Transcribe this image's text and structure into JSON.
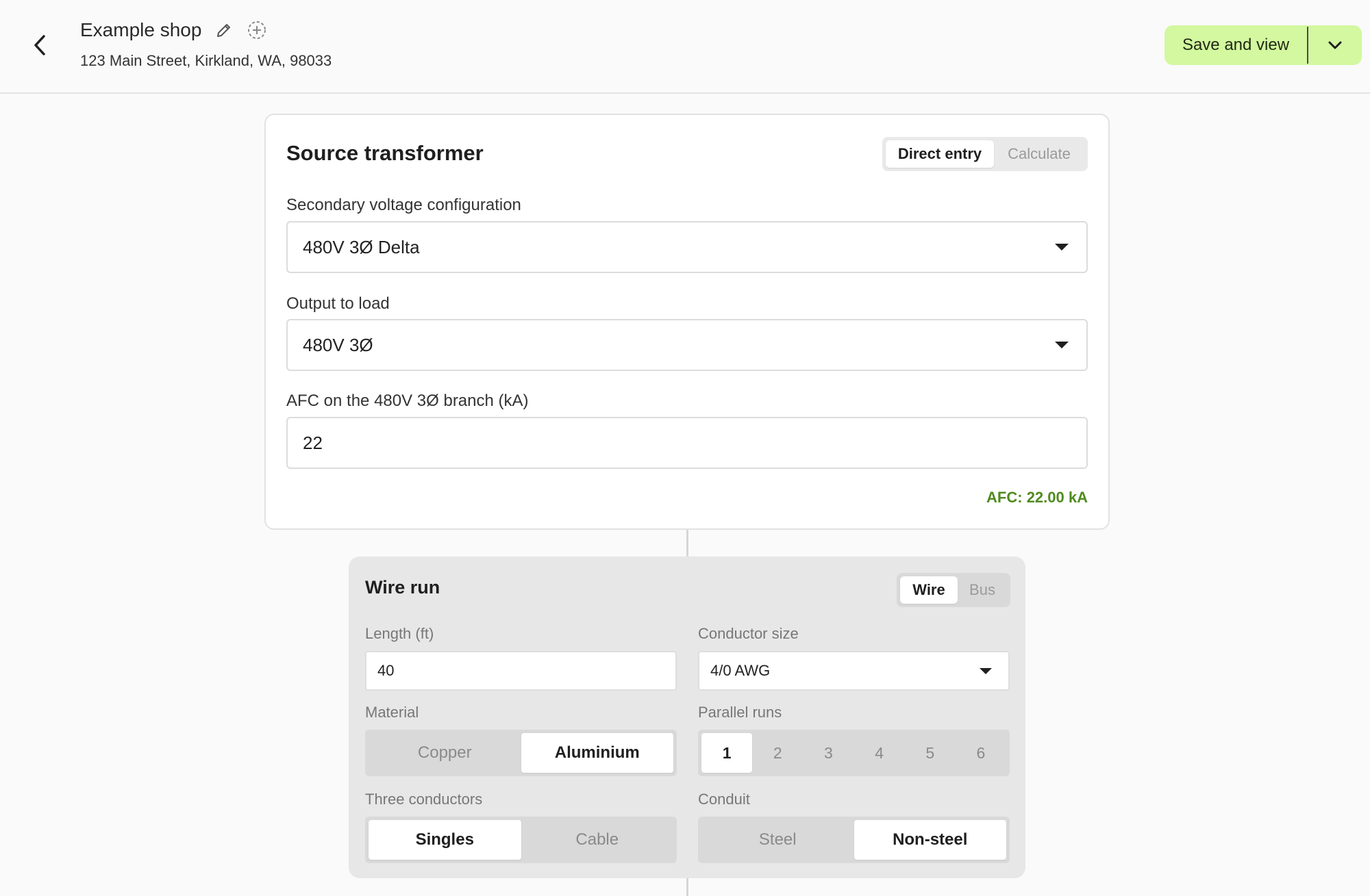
{
  "header": {
    "title": "Example shop",
    "address": "123 Main Street, Kirkland, WA, 98033",
    "save_label": "Save and view"
  },
  "source_transformer": {
    "title": "Source transformer",
    "mode_options": [
      "Direct entry",
      "Calculate"
    ],
    "mode_selected": "Direct entry",
    "secondary_voltage_label": "Secondary voltage configuration",
    "secondary_voltage_value": "480V 3Ø Delta",
    "output_label": "Output to load",
    "output_value": "480V 3Ø",
    "afc_label": "AFC on the 480V 3Ø branch (kA)",
    "afc_value": "22",
    "afc_result": "AFC: 22.00 kA",
    "afc_result_color": "#4f8a1f"
  },
  "wire_run": {
    "title": "Wire run",
    "type_options": [
      "Wire",
      "Bus"
    ],
    "type_selected": "Wire",
    "length_label": "Length (ft)",
    "length_value": "40",
    "conductor_label": "Conductor size",
    "conductor_value": "4/0 AWG",
    "material_label": "Material",
    "material_options": [
      "Copper",
      "Aluminium"
    ],
    "material_selected": "Aluminium",
    "parallel_label": "Parallel runs",
    "parallel_options": [
      "1",
      "2",
      "3",
      "4",
      "5",
      "6"
    ],
    "parallel_selected": "1",
    "three_conductors_label": "Three conductors",
    "three_conductors_options": [
      "Singles",
      "Cable"
    ],
    "three_conductors_selected": "Singles",
    "conduit_label": "Conduit",
    "conduit_options": [
      "Steel",
      "Non-steel"
    ],
    "conduit_selected": "Non-steel"
  },
  "colors": {
    "accent_green": "#d3f8a0",
    "afc_green": "#4f8a1f"
  }
}
